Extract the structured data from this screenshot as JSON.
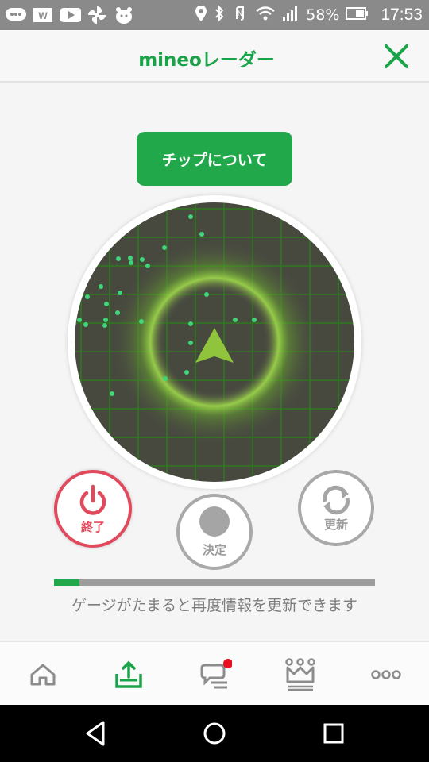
{
  "status_bar": {
    "battery": "58%",
    "time": "17:53",
    "left_icons": [
      "chat-icon",
      "w-app-icon",
      "youtube-icon",
      "pinwheel-icon",
      "mascot-icon"
    ],
    "right_icons": [
      "location-icon",
      "bluetooth-icon",
      "nfc-icon",
      "wifi-icon",
      "signal-icon",
      "battery-icon"
    ]
  },
  "header": {
    "title": "mineoレーダー",
    "close_icon": "close-icon"
  },
  "tips_button": {
    "label": "チップについて"
  },
  "radar": {
    "center_icon": "navigation-arrow-icon",
    "accent": "#8fc43c"
  },
  "buttons": {
    "end": {
      "label": "終了",
      "icon": "power-icon",
      "color": "#e04a5c"
    },
    "decide": {
      "label": "決定",
      "icon": "circle-icon"
    },
    "refresh": {
      "label": "更新",
      "icon": "refresh-icon"
    }
  },
  "gauge": {
    "fill_fraction": 0.08,
    "text": "ゲージがたまると再度情報を更新できます"
  },
  "bottom_nav": [
    {
      "name": "home-icon",
      "active": false
    },
    {
      "name": "upload-tray-icon",
      "active": true
    },
    {
      "name": "chat-icon",
      "active": false,
      "badge": true
    },
    {
      "name": "crown-icon",
      "active": false
    },
    {
      "name": "more-icon",
      "active": false
    }
  ],
  "system_nav": [
    "back-icon",
    "home-circle-icon",
    "recent-apps-icon"
  ],
  "colors": {
    "brand": "#1ba34a",
    "danger": "#e04a5c",
    "radar_bg": "#47493f",
    "grid": "#2e7a1e",
    "dots": "#3fd67a"
  }
}
